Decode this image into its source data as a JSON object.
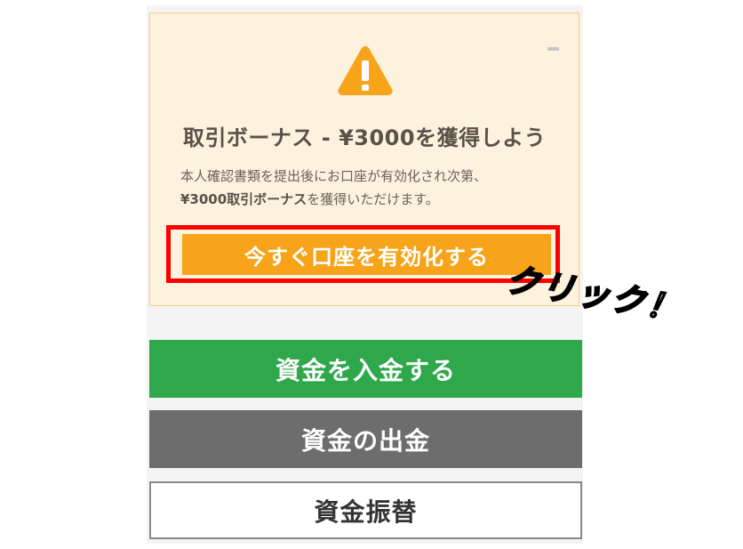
{
  "bonus": {
    "title": "取引ボーナス - ¥3000を獲得しよう",
    "description_line1": "本人確認書類を提出後にお口座が有効化され次第、",
    "description_bold": "¥3000取引ボーナス",
    "description_rest": "を獲得いただけます。",
    "activate_label": "今すぐ口座を有効化する",
    "warning_icon": "warning-triangle-icon",
    "minimize_icon": "minimize-icon"
  },
  "actions": {
    "deposit_label": "資金を入金する",
    "withdraw_label": "資金の出金",
    "transfer_label": "資金振替"
  },
  "annotation": {
    "click_text": "クリック！"
  },
  "colors": {
    "card_bg": "#fdf2dd",
    "card_border": "#f2cf8e",
    "warning": "#f7a41a",
    "activate": "#f7a41a",
    "deposit": "#2ea84a",
    "withdraw": "#6d6d6d",
    "highlight": "#ff0000"
  }
}
